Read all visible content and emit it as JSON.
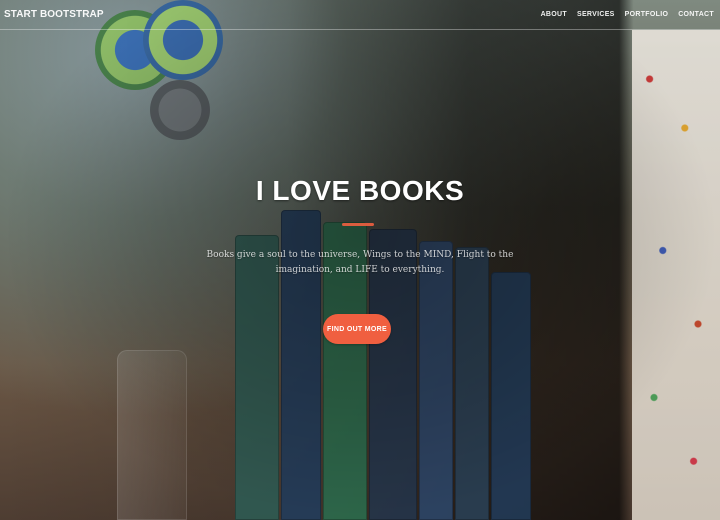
{
  "navbar": {
    "brand": "START BOOTSTRAP",
    "links": [
      "ABOUT",
      "SERVICES",
      "PORTFOLIO",
      "CONTACT"
    ]
  },
  "hero": {
    "title": "I LOVE BOOKS",
    "subtitle": "Books give a soul to the universe, Wings to the MIND, Flight to the imagination, and LIFE to everything.",
    "cta_label": "FIND OUT MORE",
    "colors": {
      "accent": "#f05f40",
      "text": "#ffffff"
    }
  }
}
